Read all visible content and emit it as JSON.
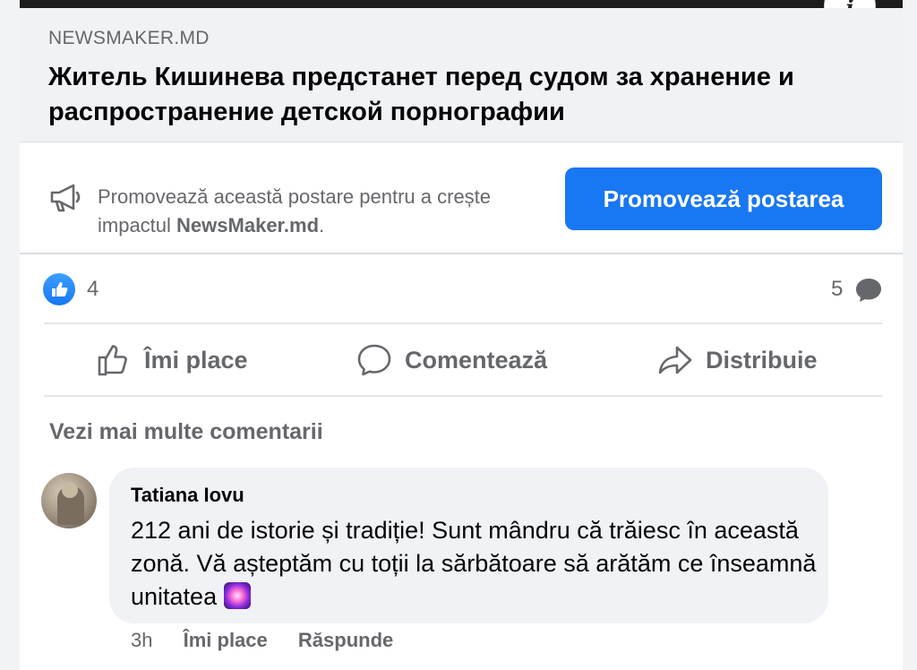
{
  "link_preview": {
    "domain": "NEWSMAKER.MD",
    "headline": "Житель Кишинева предстанет перед судом за хранение и распространение детской порнографии"
  },
  "promo": {
    "text": "Promovează această postare pentru a crește impactul ",
    "page_name": "NewsMaker.md",
    "text_end": ".",
    "button_label": "Promovează postarea"
  },
  "stats": {
    "like_count": "4",
    "comment_count": "5"
  },
  "actions": {
    "like_label": "Îmi place",
    "comment_label": "Comentează",
    "share_label": "Distribuie"
  },
  "comments_section": {
    "more_label": "Vezi mai multe comentarii"
  },
  "comment": {
    "author": "Tatiana Iovu",
    "text": "212 ani de istorie și tradiție! Sunt mândru că trăiesc în această zonă. Vă așteptăm cu toții la sărbătoare să arătăm ce înseamnă unitatea ",
    "time": "3h",
    "like_label": "Îmi place",
    "reply_label": "Răspunde"
  },
  "colors": {
    "accent": "#1877f2",
    "secondary_text": "#65676b",
    "bubble_bg": "#f0f2f5"
  }
}
